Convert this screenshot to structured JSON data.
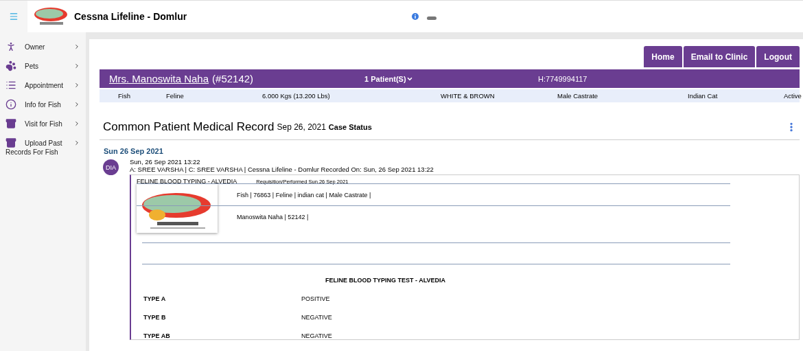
{
  "header": {
    "title": "Cessna Lifeline - Domlur"
  },
  "sidebar": {
    "items": [
      {
        "label": "Owner",
        "kind": "person"
      },
      {
        "label": "Pets",
        "kind": "paw"
      },
      {
        "label": "Appointment",
        "kind": "list"
      },
      {
        "label": "Info for Fish",
        "kind": "info"
      },
      {
        "label": "Visit for Fish",
        "kind": "box"
      },
      {
        "label": "Upload Past",
        "sublabel": "Records For Fish",
        "kind": "box"
      }
    ]
  },
  "buttons": [
    "Home",
    "Email to Clinic",
    "Logout"
  ],
  "owner_bar": {
    "name": "Mrs. Manoswita Naha",
    "id": "(#52142)",
    "patients": "1 Patient(S)",
    "phone": "H:7749994117"
  },
  "patient_row": [
    "Fish",
    "Feline",
    "6.000 Kgs (13.200 Lbs)",
    "WHITE & BROWN",
    "Male Castrate",
    "Indian Cat",
    "Active"
  ],
  "record": {
    "title": "Common Patient Medical Record",
    "date": "Sep 26, 2021",
    "status": "Case Status"
  },
  "timeline": {
    "date": "Sun 26 Sep 2021",
    "badge": "DIA",
    "time": "Sun, 26 Sep 2021 13:22",
    "meta": "A: SREE VARSHA | C: SREE VARSHA | Cessna Lifeline - Domlur Recorded On: Sun, 26 Sep 2021 13:22"
  },
  "report": {
    "name": "FELINE BLOOD TYPING - ALVEDIA",
    "requisition": "Requisition/Performed Sun,26 Sep 2021",
    "pet_line": "Fish |  76863 | Feline | indian cat | Male Castrate |",
    "owner_line": "Manoswita Naha |  52142 |",
    "test_title": "FELINE BLOOD TYPING TEST - ALVEDIA",
    "results": [
      {
        "label": "TYPE A",
        "value": "POSITIVE"
      },
      {
        "label": "TYPE B",
        "value": "NEGATIVE"
      },
      {
        "label": "TYPE AB",
        "value": "NEGATIVE"
      }
    ]
  }
}
